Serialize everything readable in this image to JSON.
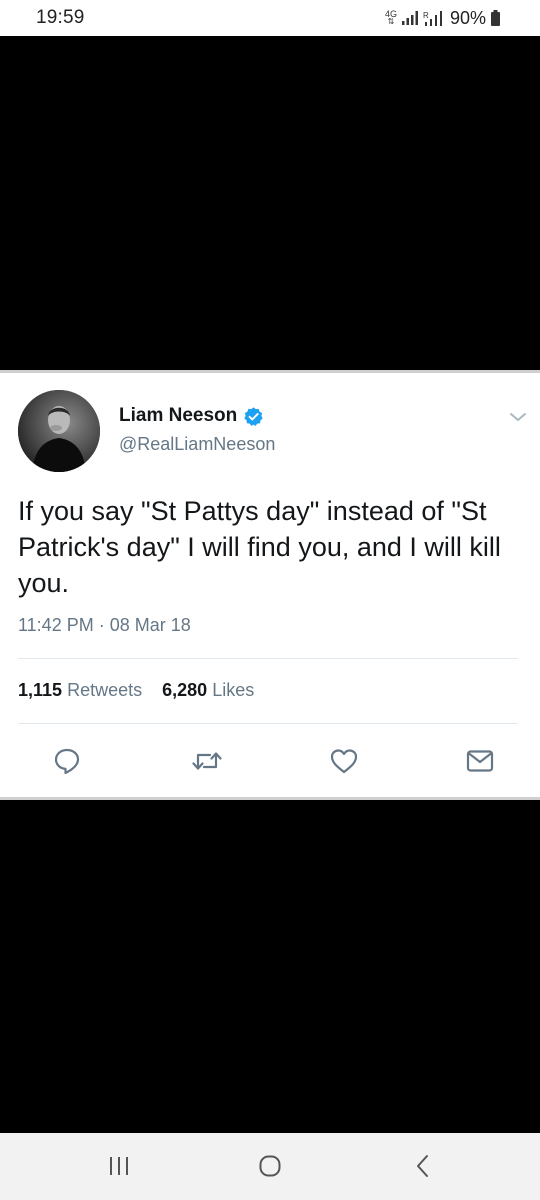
{
  "status_bar": {
    "time": "19:59",
    "network": "4G",
    "battery": "90%"
  },
  "tweet": {
    "display_name": "Liam Neeson",
    "handle": "@RealLiamNeeson",
    "verified": true,
    "text": "If you say \"St Pattys day\" instead of \"St Patrick's day\" I will find you, and I will kill you.",
    "timestamp": "11:42 PM · 08 Mar 18",
    "retweets_count": "1,115",
    "retweets_label": "Retweets",
    "likes_count": "6,280",
    "likes_label": "Likes"
  },
  "colors": {
    "verified_blue": "#1da1f2",
    "secondary_text": "#657786",
    "primary_text": "#14171a",
    "icon_gray": "#657786"
  },
  "icons": {
    "actions": [
      "reply-icon",
      "retweet-icon",
      "like-icon",
      "share-icon"
    ],
    "nav": [
      "recents-icon",
      "home-icon",
      "back-icon"
    ]
  }
}
